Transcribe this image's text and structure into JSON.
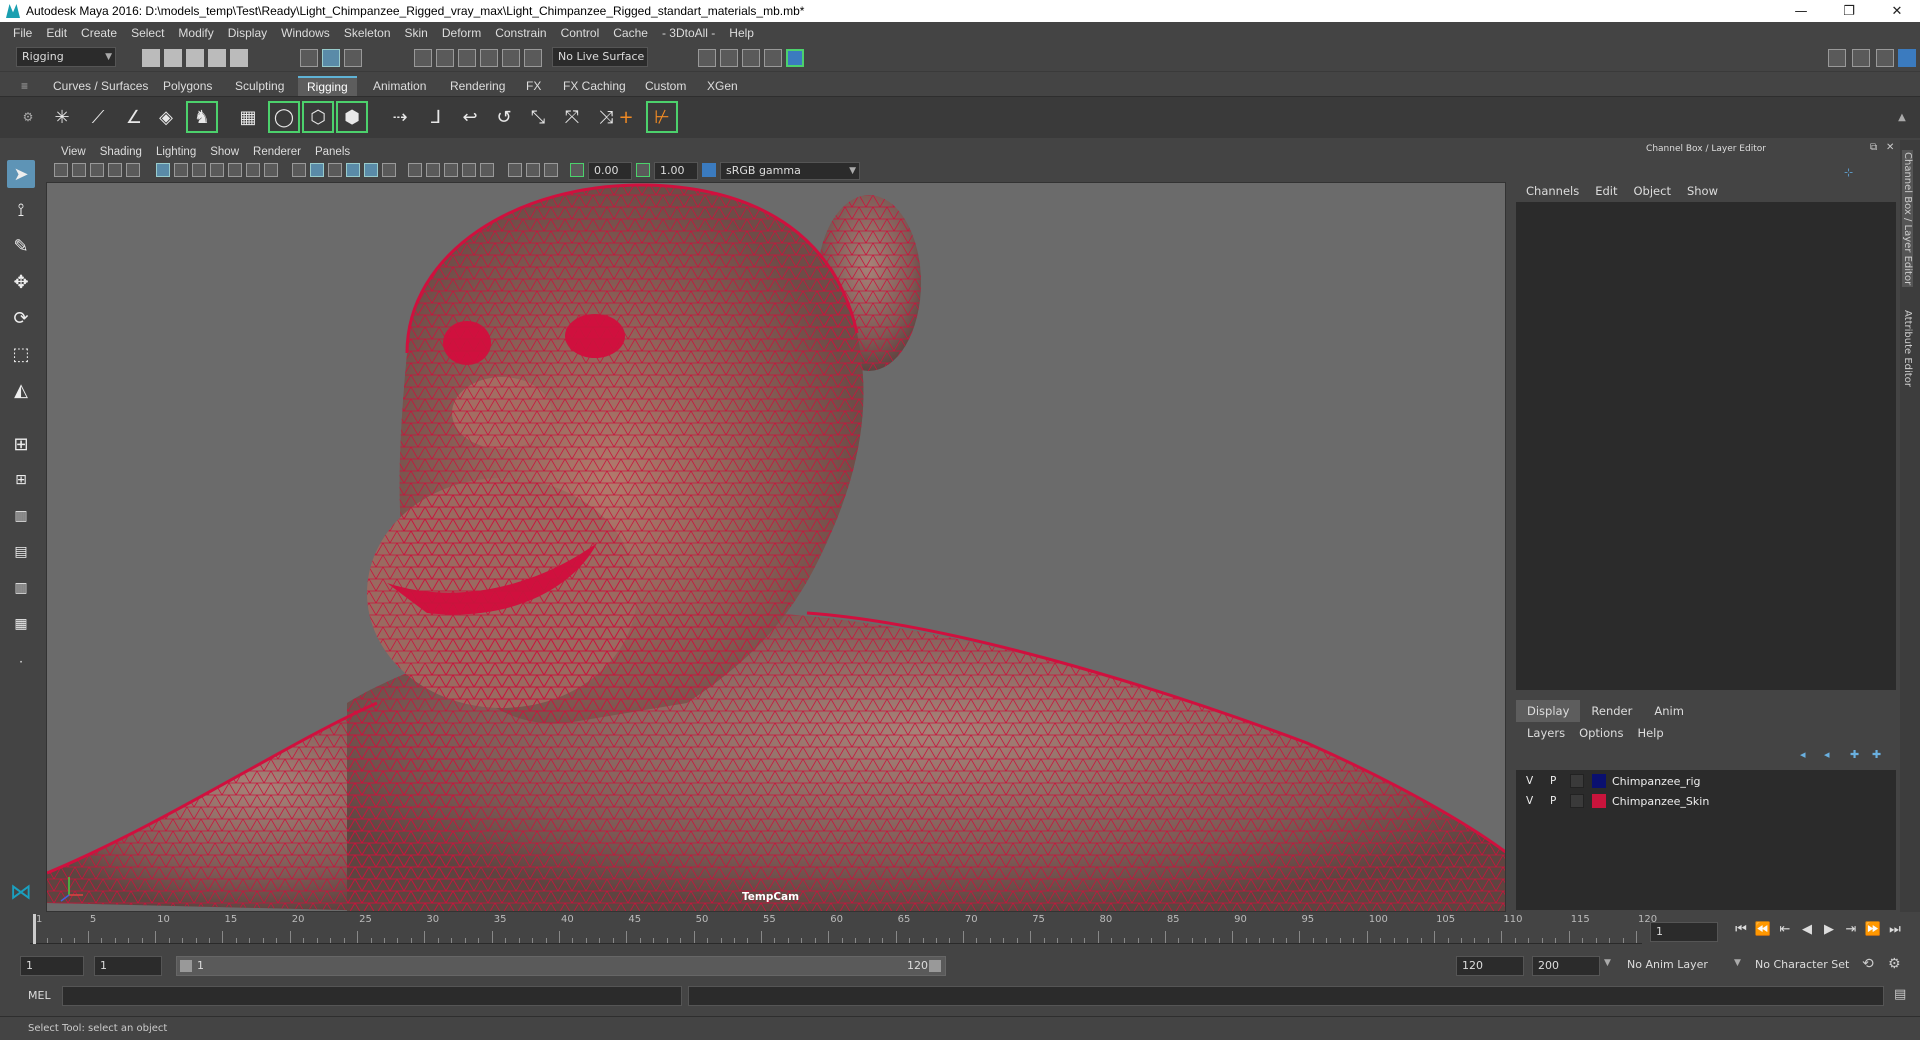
{
  "window": {
    "title": "Autodesk Maya 2016: D:\\models_temp\\Test\\Ready\\Light_Chimpanzee_Rigged_vray_max\\Light_Chimpanzee_Rigged_standart_materials_mb.mb*",
    "minimize": "—",
    "restore": "❐",
    "close": "✕"
  },
  "menubar": [
    "File",
    "Edit",
    "Create",
    "Select",
    "Modify",
    "Display",
    "Windows",
    "Skeleton",
    "Skin",
    "Deform",
    "Constrain",
    "Control",
    "Cache",
    "- 3DtoAll -",
    "Help"
  ],
  "statusline": {
    "menuset": "Rigging",
    "live_surface": "No Live Surface"
  },
  "shelf_tabs": [
    "Curves / Surfaces",
    "Polygons",
    "Sculpting",
    "Rigging",
    "Animation",
    "Rendering",
    "FX",
    "FX Caching",
    "Custom",
    "XGen"
  ],
  "shelf_active": "Rigging",
  "viewport": {
    "menus": [
      "View",
      "Shading",
      "Lighting",
      "Show",
      "Renderer",
      "Panels"
    ],
    "exposure": "0.00",
    "gamma": "1.00",
    "color_space": "sRGB gamma",
    "camera": "TempCam",
    "mesh_color": "#c8143c",
    "background": "#6b6b6b"
  },
  "channel_box": {
    "header": "Channel Box / Layer Editor",
    "menus": [
      "Channels",
      "Edit",
      "Object",
      "Show"
    ]
  },
  "layer_editor": {
    "tabs": [
      "Display",
      "Render",
      "Anim"
    ],
    "active_tab": "Display",
    "menus": [
      "Layers",
      "Options",
      "Help"
    ],
    "layers": [
      {
        "v": "V",
        "p": "P",
        "name": "Chimpanzee_rig",
        "color": "#0a1070"
      },
      {
        "v": "V",
        "p": "P",
        "name": "Chimpanzee_Skin",
        "color": "#c8143c"
      }
    ]
  },
  "side_tabs": [
    "Channel Box / Layer Editor",
    "Attribute Editor"
  ],
  "timeline": {
    "tick_labels": [
      "1",
      "5",
      "10",
      "15",
      "20",
      "25",
      "30",
      "35",
      "40",
      "45",
      "50",
      "55",
      "60",
      "65",
      "70",
      "75",
      "80",
      "85",
      "90",
      "95",
      "100",
      "105",
      "110",
      "115",
      "120"
    ],
    "current_frame": "1"
  },
  "range": {
    "start": "1",
    "playback_start": "1",
    "slider_left": "1",
    "slider_right": "120",
    "playback_end": "120",
    "end": "200",
    "anim_layer": "No Anim Layer",
    "character_set": "No Character Set"
  },
  "command": {
    "label": "MEL"
  },
  "help_line": "Select Tool: select an object"
}
